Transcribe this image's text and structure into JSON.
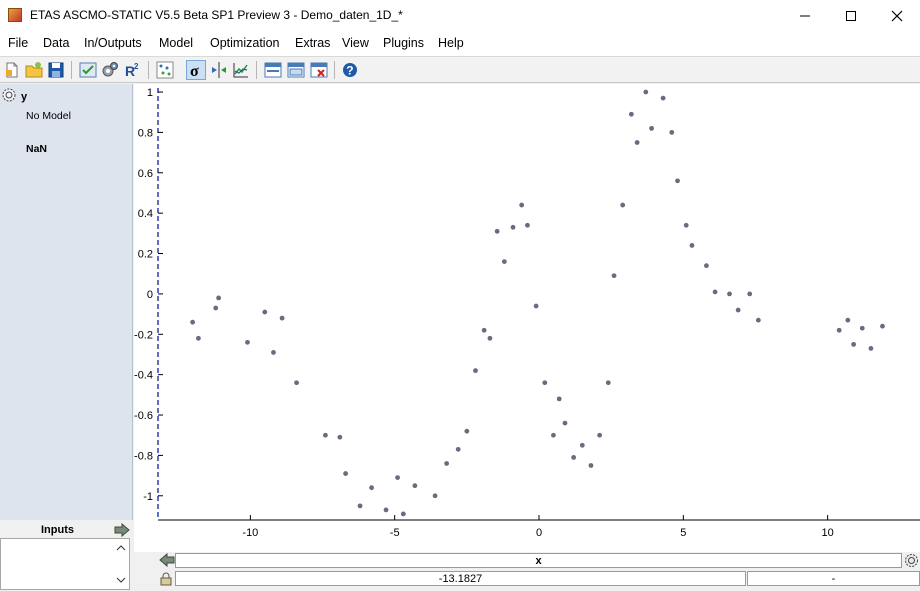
{
  "window": {
    "title": "ETAS ASCMO-STATIC V5.5 Beta SP1 Preview 3 - Demo_daten_1D_*",
    "controls": [
      "minimize",
      "maximize",
      "close"
    ]
  },
  "menu": [
    "File",
    "Data",
    "In/Outputs",
    "Model",
    "Optimization",
    "Extras",
    "View",
    "Plugins",
    "Help"
  ],
  "toolbar": {
    "icons": [
      "new-file-icon",
      "open-folder-icon",
      "save-icon",
      "check-model-icon",
      "gears-icon",
      "r-squared-icon",
      "scatter-matrix-icon",
      "sigma-icon",
      "step-icon",
      "chart-icon",
      "window-layout-icon",
      "window-layout-alt-icon",
      "close-window-icon",
      "help-icon"
    ],
    "r2_label": "R",
    "r2_sup": "2",
    "sigma_label": "σ",
    "help_label": "?"
  },
  "left_panel": {
    "output_name": "y",
    "model_status": "No Model",
    "value": "NaN",
    "inputs_label": "Inputs"
  },
  "bottom": {
    "x_label": "x",
    "x_value": "-13.1827",
    "right_value": "-"
  },
  "chart_data": {
    "type": "scatter",
    "xlim": [
      -13.2,
      13.2
    ],
    "ylim": [
      -1.12,
      1.02
    ],
    "xticks": [
      -10,
      -5,
      0,
      5,
      10
    ],
    "yticks": [
      -1,
      -0.8,
      -0.6,
      -0.4,
      -0.2,
      0,
      0.2,
      0.4,
      0.6,
      0.8,
      1
    ],
    "grid": false,
    "xlabel": "x",
    "point_color": "#6b6b80",
    "points": [
      [
        -12.0,
        -0.14
      ],
      [
        -11.1,
        -0.02
      ],
      [
        -11.8,
        -0.22
      ],
      [
        -11.2,
        -0.07
      ],
      [
        -10.1,
        -0.24
      ],
      [
        -9.5,
        -0.09
      ],
      [
        -9.2,
        -0.29
      ],
      [
        -8.9,
        -0.12
      ],
      [
        -8.4,
        -0.44
      ],
      [
        -7.4,
        -0.7
      ],
      [
        -6.9,
        -0.71
      ],
      [
        -6.7,
        -0.89
      ],
      [
        -6.2,
        -1.05
      ],
      [
        -5.8,
        -0.96
      ],
      [
        -5.3,
        -1.07
      ],
      [
        -4.9,
        -0.91
      ],
      [
        -4.7,
        -1.09
      ],
      [
        -4.3,
        -0.95
      ],
      [
        -3.6,
        -1.0
      ],
      [
        -3.2,
        -0.84
      ],
      [
        -2.8,
        -0.77
      ],
      [
        -2.5,
        -0.68
      ],
      [
        -2.2,
        -0.38
      ],
      [
        -1.9,
        -0.18
      ],
      [
        -1.7,
        -0.22
      ],
      [
        -1.45,
        0.31
      ],
      [
        -1.2,
        0.16
      ],
      [
        -0.9,
        0.33
      ],
      [
        -0.6,
        0.44
      ],
      [
        -0.4,
        0.34
      ],
      [
        -0.1,
        -0.06
      ],
      [
        0.2,
        -0.44
      ],
      [
        0.5,
        -0.7
      ],
      [
        0.7,
        -0.52
      ],
      [
        0.9,
        -0.64
      ],
      [
        1.2,
        -0.81
      ],
      [
        1.5,
        -0.75
      ],
      [
        1.8,
        -0.85
      ],
      [
        2.1,
        -0.7
      ],
      [
        2.4,
        -0.44
      ],
      [
        2.6,
        0.09
      ],
      [
        2.9,
        0.44
      ],
      [
        3.2,
        0.89
      ],
      [
        3.4,
        0.75
      ],
      [
        3.7,
        1.0
      ],
      [
        3.9,
        0.82
      ],
      [
        4.3,
        0.97
      ],
      [
        4.6,
        0.8
      ],
      [
        4.8,
        0.56
      ],
      [
        5.1,
        0.34
      ],
      [
        5.3,
        0.24
      ],
      [
        5.8,
        0.14
      ],
      [
        6.1,
        0.01
      ],
      [
        6.6,
        0.0
      ],
      [
        6.9,
        -0.08
      ],
      [
        7.3,
        0.0
      ],
      [
        7.6,
        -0.13
      ],
      [
        10.4,
        -0.18
      ],
      [
        10.7,
        -0.13
      ],
      [
        10.9,
        -0.25
      ],
      [
        11.2,
        -0.17
      ],
      [
        11.5,
        -0.27
      ],
      [
        11.9,
        -0.16
      ]
    ]
  }
}
